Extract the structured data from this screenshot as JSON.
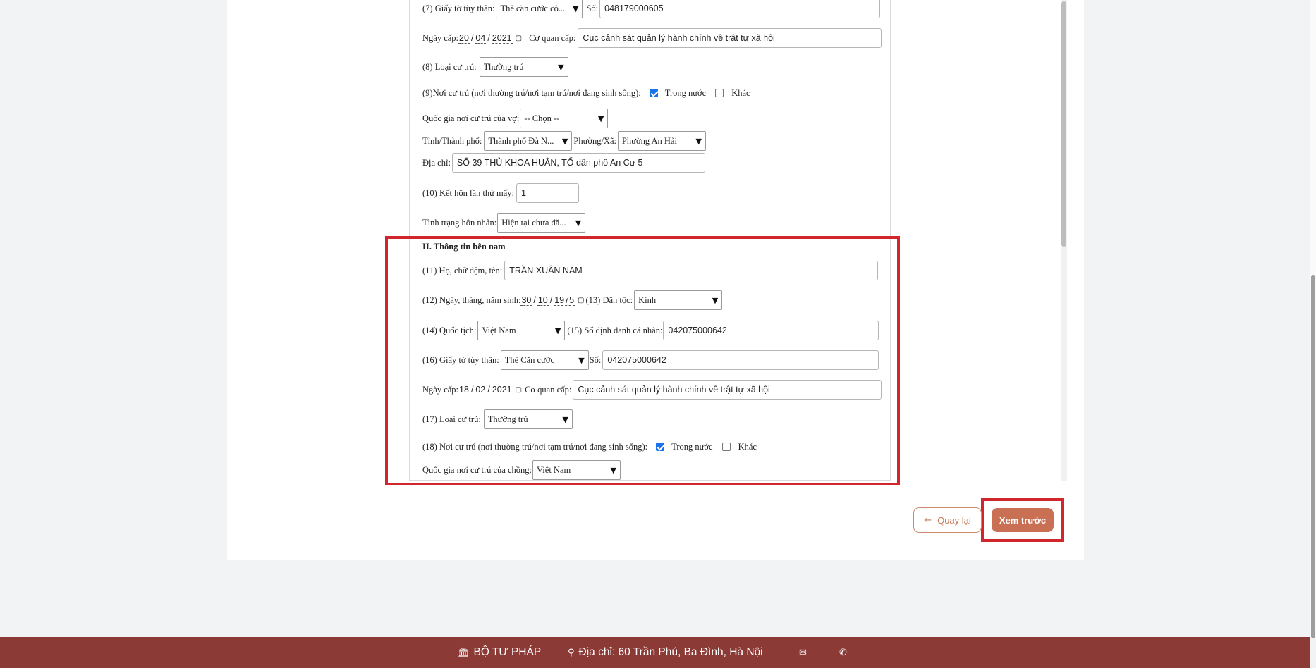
{
  "form": {
    "wife": {
      "id_doc_label": "(7) Giấy tờ tùy thân:",
      "id_doc_value": "Thẻ căn cước cô...",
      "id_no_label": "Số:",
      "id_no_value": "048179000605",
      "issue_date_label": "Ngày cấp:",
      "issue_day": "20",
      "issue_month": "04",
      "issue_year": "2021",
      "authority_label": "Cơ quan cấp:",
      "authority_value": "Cục cảnh sát quản lý hành chính về trật tự xã hội",
      "residence_type_label": "(8) Loại cư trú:",
      "residence_type_value": "Thường trú",
      "residence_place_label": "(9)Nơi cư trú (nơi thường trú/nơi tạm trú/nơi đang sinh sống):",
      "domestic_label": "Trong nước",
      "other_label": "Khác",
      "country_label": "Quốc gia nơi cư trú của vợ:",
      "country_value": "-- Chọn --",
      "province_label": "Tỉnh/Thành phố:",
      "province_value": "Thành phố Đà N...",
      "ward_label": "Phường/Xã:",
      "ward_value": "Phường An Hải",
      "address_label": "Địa chỉ:",
      "address_value": "SỐ 39 THỦ KHOA HUÂN, TỔ dân phố An Cư 5",
      "marriage_no_label": "(10) Kết hôn lần thứ mấy:",
      "marriage_no_value": "1",
      "marital_status_label": "Tình trạng hôn nhân:",
      "marital_status_value": "Hiện tại chưa đă..."
    },
    "husband": {
      "section_title": "II. Thông tin bên nam",
      "name_label": "(11) Họ, chữ đệm, tên:",
      "name_value": "TRẦN XUÂN NAM",
      "dob_label": "(12) Ngày, tháng, năm sinh:",
      "dob_day": "30",
      "dob_month": "10",
      "dob_year": "1975",
      "ethnic_label": "(13) Dân tộc:",
      "ethnic_value": "Kinh",
      "nationality_label": "(14) Quốc tịch:",
      "nationality_value": "Việt Nam",
      "personal_id_label": "(15) Số định danh cá nhân:",
      "personal_id_value": "042075000642",
      "id_doc_label": "(16) Giấy tờ tùy thân:",
      "id_doc_value": "Thẻ Căn cước",
      "id_no_label": "Số:",
      "id_no_value": "042075000642",
      "issue_date_label": "Ngày cấp:",
      "issue_day": "18",
      "issue_month": "02",
      "issue_year": "2021",
      "authority_label": "Cơ quan cấp:",
      "authority_value": "Cục cảnh sát quản lý hành chính về trật tự xã hội",
      "residence_type_label": "(17) Loại cư trú:",
      "residence_type_value": "Thường trú",
      "residence_place_label": "(18) Nơi cư trú (nơi thường trú/nơi tạm trú/nơi đang sinh sống):",
      "domestic_label": "Trong nước",
      "other_label": "Khác",
      "country_label": "Quốc gia nơi cư trú của chồng:",
      "country_value": "Việt Nam"
    }
  },
  "actions": {
    "back_label": "Quay lại",
    "preview_label": "Xem trước"
  },
  "footer": {
    "org_name": "BỘ TƯ PHÁP",
    "address": "Địa chỉ: 60 Trần Phú, Ba Đình, Hà Nội"
  },
  "icons": {
    "calendar": "calendar-icon",
    "dropdown": "chevron-down-icon",
    "back": "arrow-left-icon",
    "org": "building-icon",
    "location": "map-pin-icon",
    "mail": "mail-icon",
    "phone": "phone-icon"
  },
  "colors": {
    "highlight": "#d0262c",
    "footer_bg": "#8b3a36",
    "primary_button": "#c96f53",
    "checkbox_checked": "#1a73e8"
  }
}
